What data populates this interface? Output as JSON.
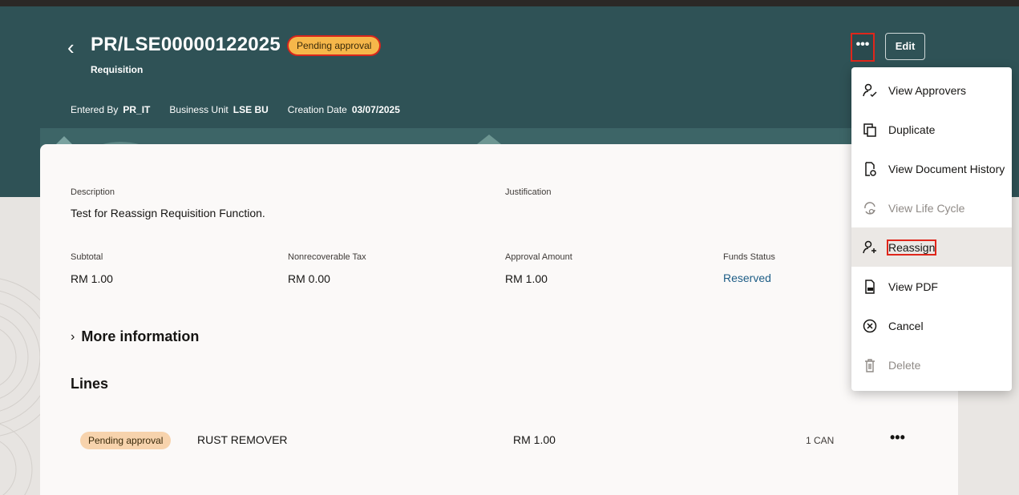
{
  "header": {
    "back_glyph": "‹",
    "title": "PR/LSE00000122025",
    "status": "Pending approval",
    "subtitle": "Requisition",
    "meta": {
      "entered_by_label": "Entered By",
      "entered_by_value": "PR_IT",
      "business_unit_label": "Business Unit",
      "business_unit_value": "LSE BU",
      "creation_date_label": "Creation Date",
      "creation_date_value": "03/07/2025"
    },
    "more_glyph": "•••",
    "edit_label": "Edit",
    "colors": {
      "header_bg": "#2f5256",
      "highlight_red": "#e0261b",
      "status_orange": "#f6b74a"
    }
  },
  "details": {
    "description_label": "Description",
    "description_value": "Test for Reassign Requisition Function.",
    "justification_label": "Justification",
    "subtotal_label": "Subtotal",
    "subtotal_value": "RM 1.00",
    "tax_label": "Nonrecoverable Tax",
    "tax_value": "RM 0.00",
    "approval_label": "Approval Amount",
    "approval_value": "RM 1.00",
    "funds_label": "Funds Status",
    "funds_value": "Reserved",
    "more_info_chevron": "›",
    "more_info_label": "More information",
    "lines_heading": "Lines"
  },
  "lines": [
    {
      "status": "Pending approval",
      "item": "RUST REMOVER",
      "amount": "RM 1.00",
      "quantity": "1 CAN",
      "more_glyph": "•••"
    }
  ],
  "menu": {
    "items": [
      {
        "label": "View Approvers",
        "icon": "person-check-icon",
        "disabled": false
      },
      {
        "label": "Duplicate",
        "icon": "duplicate-icon",
        "disabled": false
      },
      {
        "label": "View Document History",
        "icon": "document-history-icon",
        "disabled": false
      },
      {
        "label": "View Life Cycle",
        "icon": "life-cycle-icon",
        "disabled": true
      },
      {
        "label": "Reassign",
        "icon": "person-add-icon",
        "disabled": false,
        "highlighted": true
      },
      {
        "label": "View PDF",
        "icon": "pdf-icon",
        "disabled": false
      },
      {
        "label": "Cancel",
        "icon": "cancel-circle-icon",
        "disabled": false
      },
      {
        "label": "Delete",
        "icon": "trash-icon",
        "disabled": true
      }
    ]
  }
}
